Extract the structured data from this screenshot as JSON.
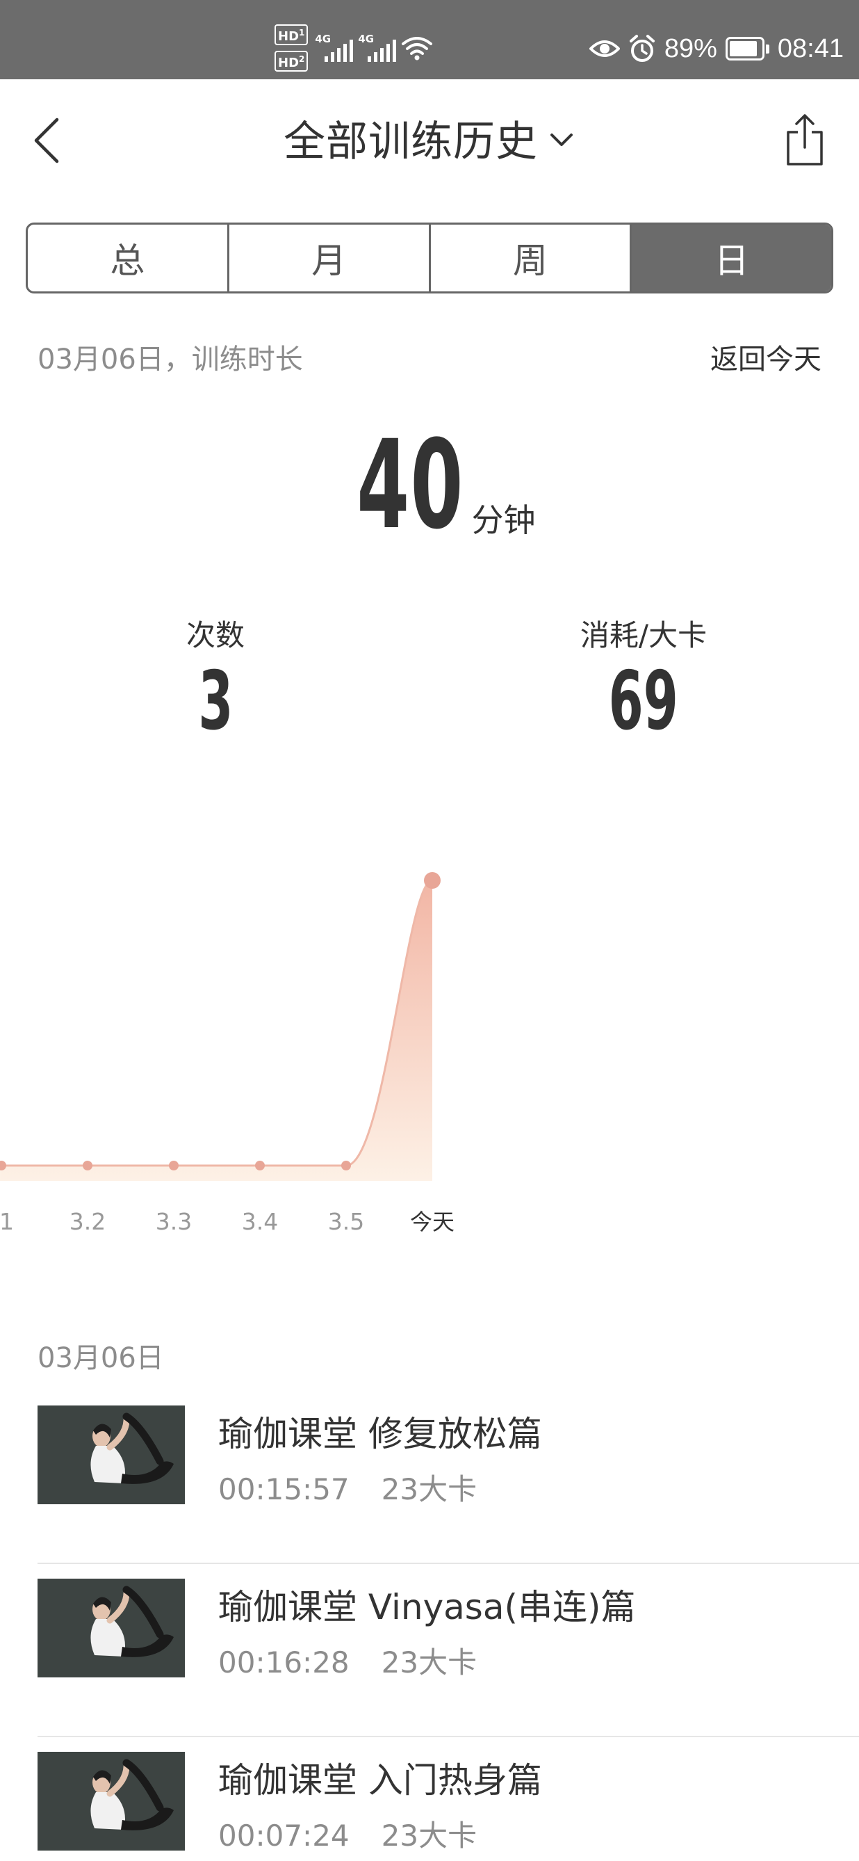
{
  "status_bar": {
    "hd1": "HD",
    "hd1_sub": "1",
    "hd2": "HD",
    "hd2_sub": "2",
    "net1": "4G",
    "net2": "4G",
    "battery_text": "89%",
    "battery_level": 0.89,
    "time": "08:41",
    "icons": [
      "eye-icon",
      "alarm-icon",
      "battery-icon",
      "wifi-icon"
    ]
  },
  "header": {
    "title": "全部训练历史"
  },
  "tabs": [
    {
      "label": "总",
      "active": false
    },
    {
      "label": "月",
      "active": false
    },
    {
      "label": "周",
      "active": false
    },
    {
      "label": "日",
      "active": true
    }
  ],
  "summary": {
    "date_label": "03月06日，训练时长",
    "back_today": "返回今天",
    "duration_value": "40",
    "duration_unit": "分钟",
    "count_label": "次数",
    "count_value": "3",
    "calories_label": "消耗/大卡",
    "calories_value": "69"
  },
  "chart_data": {
    "type": "area",
    "categories": [
      "1",
      "3.2",
      "3.3",
      "3.4",
      "3.5",
      "今天"
    ],
    "values": [
      0,
      0,
      0,
      0,
      0,
      40
    ],
    "highlight_index": 5,
    "colors": {
      "point": "#e8a697",
      "line": "#efb8a8",
      "fill_top": "#f2b6a5",
      "fill_bottom": "#fdf1e6"
    },
    "grid": false
  },
  "history": {
    "date": "03月06日",
    "items": [
      {
        "title": "瑜伽课堂  修复放松篇",
        "time": "00:15:57",
        "calories": "23大卡"
      },
      {
        "title": "瑜伽课堂  Vinyasa(串连)篇",
        "time": "00:16:28",
        "calories": "23大卡"
      },
      {
        "title": "瑜伽课堂  入门热身篇",
        "time": "00:07:24",
        "calories": "23大卡"
      }
    ]
  }
}
